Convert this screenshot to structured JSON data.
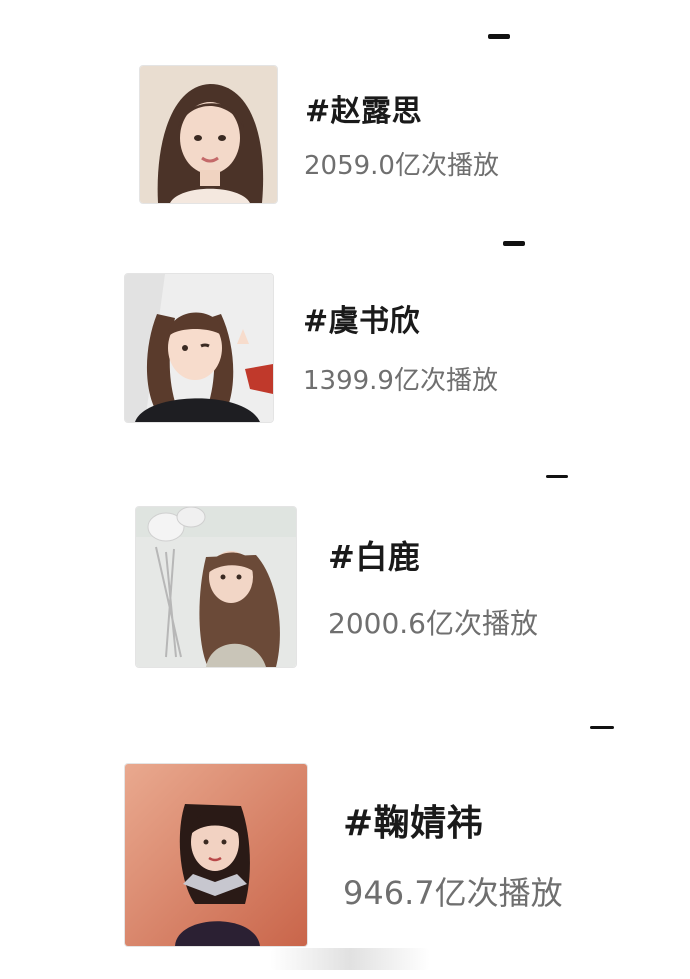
{
  "items": [
    {
      "tag": "#赵露思",
      "plays": "2059.0亿次播放",
      "avatar_icon": "portrait-photo"
    },
    {
      "tag": "#虞书欣",
      "plays": "1399.9亿次播放",
      "avatar_icon": "portrait-photo"
    },
    {
      "tag": "#白鹿",
      "plays": "2000.6亿次播放",
      "avatar_icon": "portrait-photo"
    },
    {
      "tag": "#鞠婧祎",
      "plays": "946.7亿次播放",
      "avatar_icon": "portrait-photo"
    }
  ]
}
